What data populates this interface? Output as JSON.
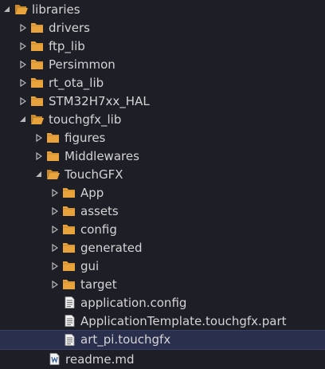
{
  "tree": {
    "root": {
      "label": "libraries",
      "icon": "folder-open-icon",
      "expanded": true
    },
    "items": [
      {
        "label": "drivers",
        "icon": "folder-icon",
        "expanded": false
      },
      {
        "label": "ftp_lib",
        "icon": "folder-icon",
        "expanded": false
      },
      {
        "label": "Persimmon",
        "icon": "folder-icon",
        "expanded": false
      },
      {
        "label": "rt_ota_lib",
        "icon": "folder-icon",
        "expanded": false
      },
      {
        "label": "STM32H7xx_HAL",
        "icon": "folder-icon",
        "expanded": false
      },
      {
        "label": "touchgfx_lib",
        "icon": "folder-open-icon",
        "expanded": true
      },
      {
        "label": "figures",
        "icon": "folder-icon",
        "expanded": false
      },
      {
        "label": "Middlewares",
        "icon": "folder-icon",
        "expanded": false
      },
      {
        "label": "TouchGFX",
        "icon": "folder-open-icon",
        "expanded": true
      },
      {
        "label": "App",
        "icon": "folder-icon",
        "expanded": false
      },
      {
        "label": "assets",
        "icon": "folder-icon",
        "expanded": false
      },
      {
        "label": "config",
        "icon": "folder-icon",
        "expanded": false
      },
      {
        "label": "generated",
        "icon": "folder-icon",
        "expanded": false
      },
      {
        "label": "gui",
        "icon": "folder-icon",
        "expanded": false
      },
      {
        "label": "target",
        "icon": "folder-icon",
        "expanded": false
      },
      {
        "label": "application.config",
        "icon": "file-icon"
      },
      {
        "label": "ApplicationTemplate.touchgfx.part",
        "icon": "file-icon"
      },
      {
        "label": "art_pi.touchgfx",
        "icon": "file-icon",
        "selected": true
      },
      {
        "label": "readme.md",
        "icon": "word-document-icon"
      }
    ]
  },
  "colors": {
    "background": "#1e1f26",
    "folder": "#e8a33c",
    "text": "#d4d4d4",
    "selection": "#2b2f4e"
  }
}
